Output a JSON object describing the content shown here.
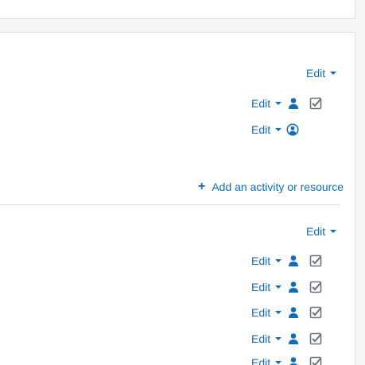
{
  "section_top": {
    "edit_label": "Edit"
  },
  "activities_a": [
    {
      "edit_label": "Edit",
      "status_icon": "user-icon",
      "completion_icon": "checkbox-checked-icon"
    },
    {
      "edit_label": "Edit",
      "status_icon": "user-circle-icon",
      "completion_icon": ""
    }
  ],
  "add_activity": {
    "label": "Add an activity or resource",
    "icon": "plus-icon"
  },
  "section_second": {
    "edit_label": "Edit"
  },
  "activities_b": [
    {
      "edit_label": "Edit",
      "status_icon": "user-icon",
      "completion_icon": "checkbox-checked-icon"
    },
    {
      "edit_label": "Edit",
      "status_icon": "user-icon",
      "completion_icon": "checkbox-checked-icon"
    },
    {
      "edit_label": "Edit",
      "status_icon": "user-icon",
      "completion_icon": "checkbox-checked-icon"
    },
    {
      "edit_label": "Edit",
      "status_icon": "user-icon",
      "completion_icon": "checkbox-checked-icon"
    },
    {
      "edit_label": "Edit",
      "status_icon": "user-icon",
      "completion_icon": "checkbox-checked-icon"
    }
  ],
  "colors": {
    "link": "#0f6cbf",
    "checkbox": "#6a737b",
    "border": "#dedede",
    "background": "#f7f7f7"
  }
}
